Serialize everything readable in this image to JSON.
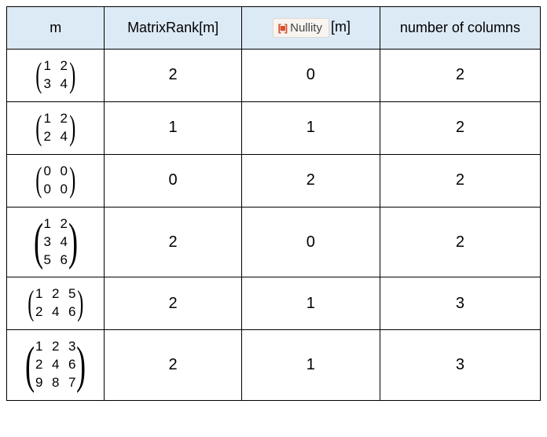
{
  "headers": {
    "m": "m",
    "rank": "MatrixRank[m]",
    "nullity_label": "Nullity",
    "nullity_suffix": "[m]",
    "cols": "number of columns"
  },
  "rows": [
    {
      "matrix": [
        [
          1,
          2
        ],
        [
          3,
          4
        ]
      ],
      "rank": 2,
      "nullity": 0,
      "cols": 2
    },
    {
      "matrix": [
        [
          1,
          2
        ],
        [
          2,
          4
        ]
      ],
      "rank": 1,
      "nullity": 1,
      "cols": 2
    },
    {
      "matrix": [
        [
          0,
          0
        ],
        [
          0,
          0
        ]
      ],
      "rank": 0,
      "nullity": 2,
      "cols": 2
    },
    {
      "matrix": [
        [
          1,
          2
        ],
        [
          3,
          4
        ],
        [
          5,
          6
        ]
      ],
      "rank": 2,
      "nullity": 0,
      "cols": 2
    },
    {
      "matrix": [
        [
          1,
          2,
          5
        ],
        [
          2,
          4,
          6
        ]
      ],
      "rank": 2,
      "nullity": 1,
      "cols": 3
    },
    {
      "matrix": [
        [
          1,
          2,
          3
        ],
        [
          2,
          4,
          6
        ],
        [
          9,
          8,
          7
        ]
      ],
      "rank": 2,
      "nullity": 1,
      "cols": 3
    }
  ],
  "chart_data": {
    "type": "table",
    "title": "",
    "columns": [
      "m",
      "MatrixRank[m]",
      "Nullity[m]",
      "number of columns"
    ],
    "data": [
      {
        "m": [
          [
            1,
            2
          ],
          [
            3,
            4
          ]
        ],
        "MatrixRank[m]": 2,
        "Nullity[m]": 0,
        "number of columns": 2
      },
      {
        "m": [
          [
            1,
            2
          ],
          [
            2,
            4
          ]
        ],
        "MatrixRank[m]": 1,
        "Nullity[m]": 1,
        "number of columns": 2
      },
      {
        "m": [
          [
            0,
            0
          ],
          [
            0,
            0
          ]
        ],
        "MatrixRank[m]": 0,
        "Nullity[m]": 2,
        "number of columns": 2
      },
      {
        "m": [
          [
            1,
            2
          ],
          [
            3,
            4
          ],
          [
            5,
            6
          ]
        ],
        "MatrixRank[m]": 2,
        "Nullity[m]": 0,
        "number of columns": 2
      },
      {
        "m": [
          [
            1,
            2,
            5
          ],
          [
            2,
            4,
            6
          ]
        ],
        "MatrixRank[m]": 2,
        "Nullity[m]": 1,
        "number of columns": 3
      },
      {
        "m": [
          [
            1,
            2,
            3
          ],
          [
            2,
            4,
            6
          ],
          [
            9,
            8,
            7
          ]
        ],
        "MatrixRank[m]": 2,
        "Nullity[m]": 1,
        "number of columns": 3
      }
    ]
  }
}
